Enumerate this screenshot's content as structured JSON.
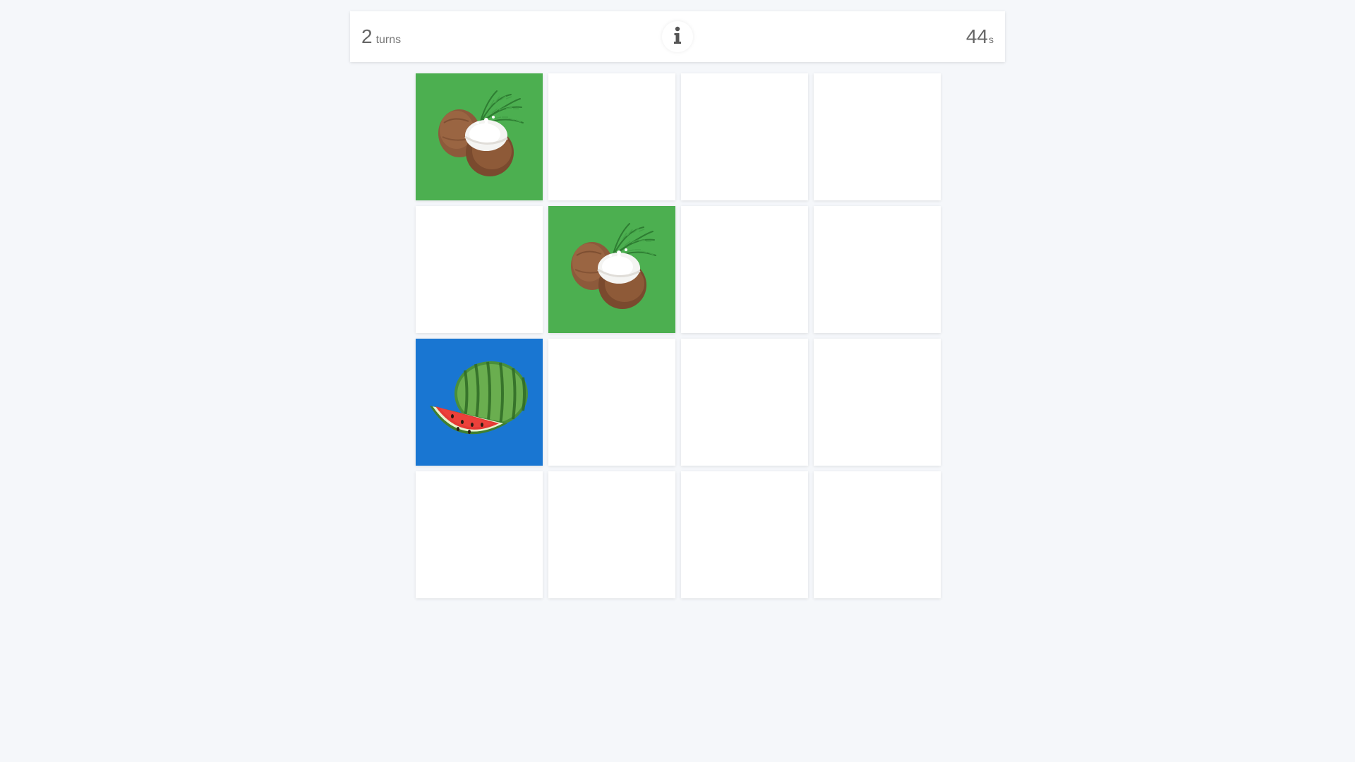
{
  "header": {
    "turns_value": "2",
    "turns_unit": "turns",
    "timer_value": "44",
    "timer_unit": "s",
    "info_icon": "info-icon"
  },
  "colors": {
    "background": "#f5f7fa",
    "card_back": "#ffffff",
    "coconut_card": "#4caf50",
    "watermelon_card": "#1976d2"
  },
  "board": {
    "rows": 4,
    "columns": 4,
    "cards": [
      {
        "state": "revealed",
        "fruit": "coconut",
        "color": "#4caf50"
      },
      {
        "state": "hidden"
      },
      {
        "state": "hidden"
      },
      {
        "state": "hidden"
      },
      {
        "state": "hidden"
      },
      {
        "state": "revealed",
        "fruit": "coconut",
        "color": "#4caf50"
      },
      {
        "state": "hidden"
      },
      {
        "state": "hidden"
      },
      {
        "state": "revealed",
        "fruit": "watermelon",
        "color": "#1976d2"
      },
      {
        "state": "hidden"
      },
      {
        "state": "hidden"
      },
      {
        "state": "hidden"
      },
      {
        "state": "hidden"
      },
      {
        "state": "hidden"
      },
      {
        "state": "hidden"
      },
      {
        "state": "hidden"
      }
    ]
  }
}
